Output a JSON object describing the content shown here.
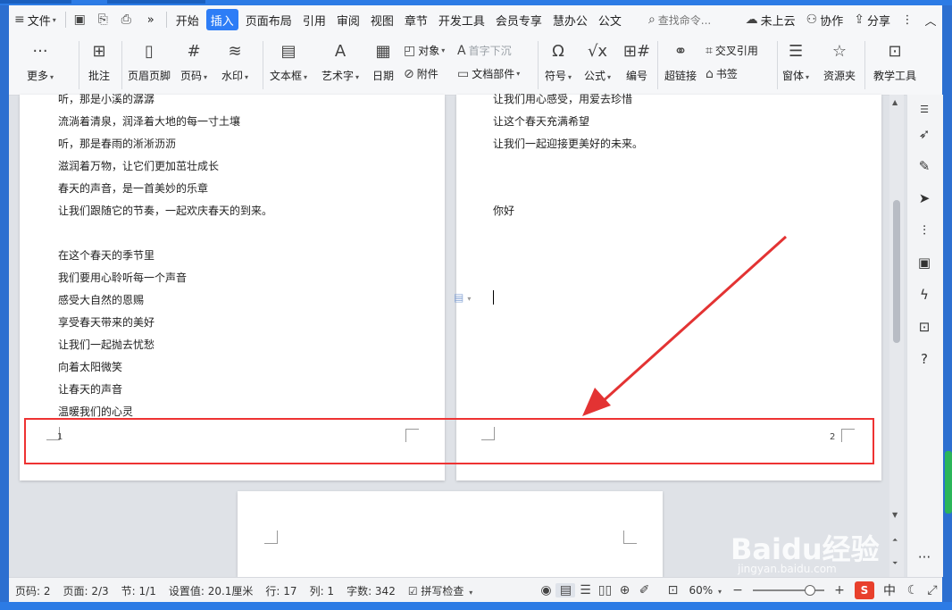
{
  "menubar": {
    "file_label": "文件",
    "more_glyph": "»",
    "tabs": [
      "开始",
      "插入",
      "页面布局",
      "引用",
      "审阅",
      "视图",
      "章节",
      "开发工具",
      "会员专享",
      "慧办公",
      "公文"
    ],
    "active_tab": "插入",
    "search_placeholder": "查找命令...",
    "cloud_label": "未上云",
    "collab_label": "协作",
    "share_label": "分享"
  },
  "ribbon": {
    "items": {
      "more": "更多",
      "comment": "批注",
      "header_footer": "页眉页脚",
      "page_number": "页码",
      "watermark": "水印",
      "textbox": "文本框",
      "wordart": "艺术字",
      "date": "日期",
      "object": "对象",
      "dropcap": "首字下沉",
      "attachment": "附件",
      "doc_parts": "文档部件",
      "symbol": "符号",
      "formula": "公式",
      "numbering": "编号",
      "hyperlink": "超链接",
      "cross_ref": "交叉引用",
      "bookmark": "书签",
      "window": "窗体",
      "resources": "资源夹",
      "teaching": "教学工具"
    }
  },
  "document": {
    "page1_lines": [
      "听，那是小溪的潺潺",
      "流淌着清泉，润泽着大地的每一寸土壤",
      "听，那是春雨的淅淅沥沥",
      "滋润着万物，让它们更加茁壮成长",
      "春天的声音，是一首美妙的乐章",
      "让我们跟随它的节奏，一起欢庆春天的到来。",
      "",
      "在这个春天的季节里",
      "我们要用心聆听每一个声音",
      "感受大自然的恩赐",
      "享受春天带来的美好",
      "让我们一起抛去忧愁",
      "向着太阳微笑",
      "让春天的声音",
      "温暖我们的心灵"
    ],
    "page2_lines": [
      "让我们用心感受，用爱去珍惜",
      "让这个春天充满希望",
      "让我们一起迎接更美好的未来。",
      "",
      "",
      "你好"
    ],
    "page1_number": "1",
    "page2_number": "2"
  },
  "statusbar": {
    "page": "页码: 2",
    "pages": "页面: 2/3",
    "section": "节: 1/1",
    "setting": "设置值: 20.1厘米",
    "row": "行: 17",
    "col": "列: 1",
    "words": "字数: 342",
    "spell": "拼写检查",
    "zoom": "60%",
    "zoom_fraction": 0.6,
    "ime_mode": "中"
  },
  "watermark": {
    "brand": "Baidu经验",
    "url": "jingyan.baidu.com"
  },
  "colors": {
    "accent": "#2d7df6",
    "highlight_box": "#e33333",
    "arrow": "#e33333"
  },
  "icons": {
    "sidebar": [
      "rocket-icon",
      "pen-icon",
      "pointer-icon",
      "sliders-icon",
      "image-edit-icon",
      "bolt-icon",
      "book-search-icon",
      "help-icon"
    ]
  }
}
